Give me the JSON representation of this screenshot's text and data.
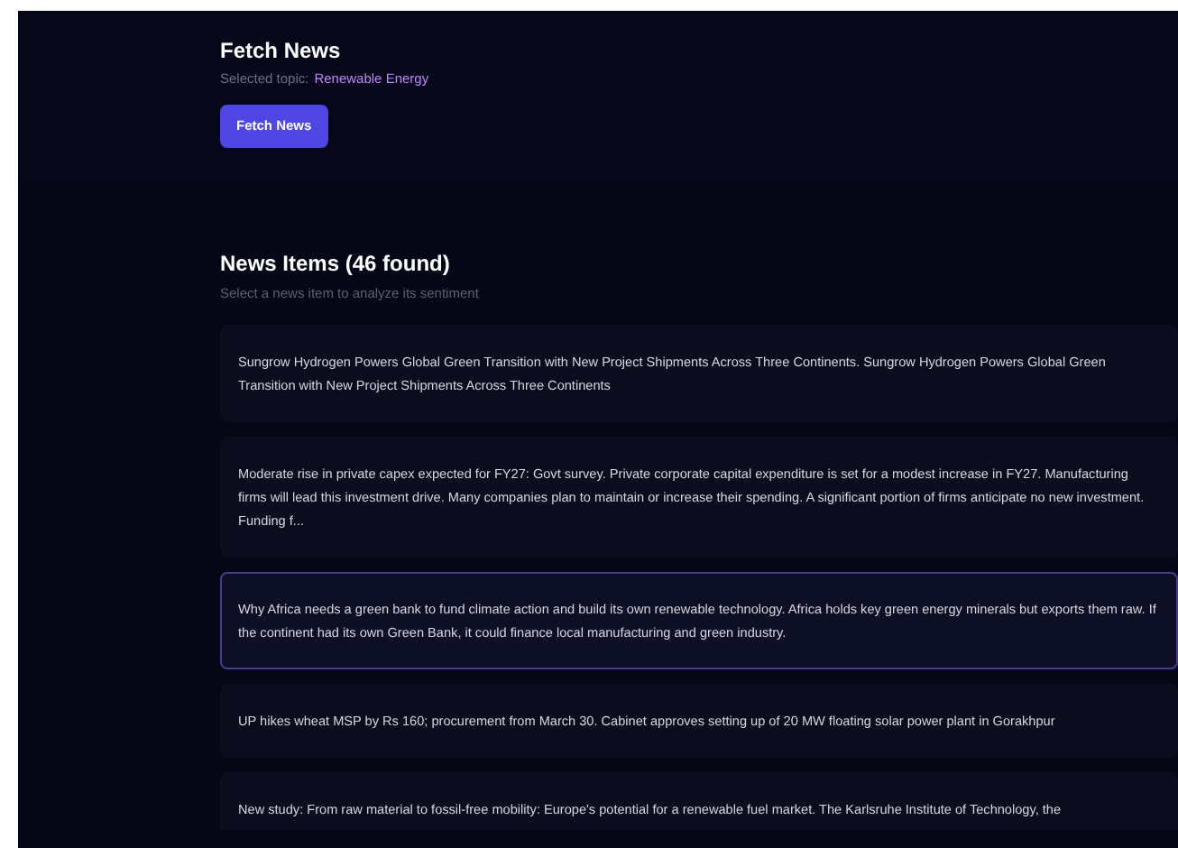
{
  "fetch": {
    "title": "Fetch News",
    "topic_label": "Selected topic:",
    "topic": "Renewable Energy",
    "button": "Fetch News"
  },
  "news": {
    "title": "News Items (46 found)",
    "subtitle": "Select a news item to analyze its sentiment",
    "items": [
      {
        "text": "Sungrow Hydrogen Powers Global Green Transition with New Project Shipments Across Three Continents. Sungrow Hydrogen Powers Global Green Transition with New Project Shipments Across Three Continents",
        "selected": false
      },
      {
        "text": "Moderate rise in private capex expected for FY27: Govt survey. Private corporate capital expenditure is set for a modest increase in FY27. Manufacturing firms will lead this investment drive. Many companies plan to maintain or increase their spending. A significant portion of firms anticipate no new investment. Funding f...",
        "selected": false
      },
      {
        "text": "Why Africa needs a green bank to fund climate action and build its own renewable technology. Africa holds key green energy minerals but exports them raw. If the continent had its own Green Bank, it could finance local manufacturing and green industry.",
        "selected": true
      },
      {
        "text": "UP hikes wheat MSP by Rs 160; procurement from March 30. Cabinet approves setting up of 20 MW floating solar power plant in Gorakhpur",
        "selected": false
      },
      {
        "text": "New study: From raw material to fossil-free mobility: Europe's potential for a renewable fuel market. The Karlsruhe Institute of Technology, the",
        "selected": false
      }
    ]
  }
}
